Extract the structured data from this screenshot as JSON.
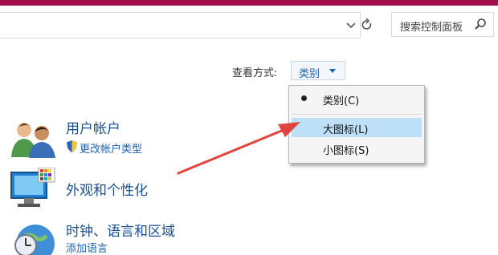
{
  "window": {
    "accent_color": "#a00f4d"
  },
  "address_bar": {
    "dropdown_icon": "chevron-down-icon",
    "refresh_icon": "refresh-icon"
  },
  "search": {
    "placeholder": "搜索控制面板",
    "icon": "search-icon"
  },
  "view_by": {
    "label": "查看方式:",
    "value": "类别"
  },
  "view_menu": {
    "items": [
      {
        "label": "类别(C)",
        "selected": true,
        "highlighted": false
      },
      {
        "label": "大图标(L)",
        "selected": false,
        "highlighted": true
      },
      {
        "label": "小图标(S)",
        "selected": false,
        "highlighted": false
      }
    ]
  },
  "categories": [
    {
      "title": "用户帐户",
      "icon": "users-icon",
      "links": [
        {
          "label": "更改帐户类型",
          "icon": "shield-icon"
        }
      ]
    },
    {
      "title": "外观和个性化",
      "icon": "display-icon",
      "links": []
    },
    {
      "title": "时钟、语言和区域",
      "icon": "clock-globe-icon",
      "links": [
        {
          "label": "添加语言"
        }
      ]
    }
  ],
  "annotation": {
    "arrow_color": "#e0443f"
  }
}
